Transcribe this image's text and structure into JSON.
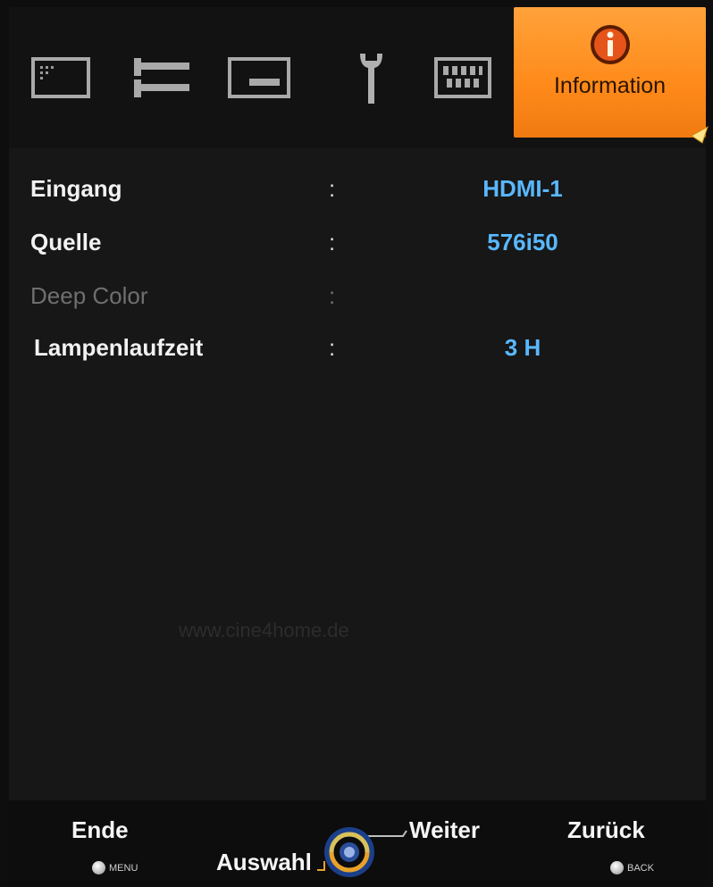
{
  "tabs": [
    {
      "icon": "picture-icon"
    },
    {
      "icon": "signal-input-icon"
    },
    {
      "icon": "screen-icon"
    },
    {
      "icon": "wrench-icon"
    },
    {
      "icon": "memory-icon"
    },
    {
      "icon": "info-icon",
      "label": "Information",
      "active": true
    }
  ],
  "info_rows": [
    {
      "label": "Eingang",
      "colon": ":",
      "value": "HDMI-1"
    },
    {
      "label": "Quelle",
      "colon": ":",
      "value": "576i50"
    },
    {
      "label": "Deep Color",
      "colon": ":",
      "value": ""
    },
    {
      "label": "Lampenlaufzeit",
      "colon": ":",
      "value": "3 H"
    }
  ],
  "watermark": "www.cine4home.de",
  "footer": {
    "end": {
      "label": "Ende",
      "key": "MENU"
    },
    "select": {
      "label": "Auswahl"
    },
    "next": {
      "label": "Weiter"
    },
    "back": {
      "label": "Zurück",
      "key": "BACK"
    }
  },
  "colors": {
    "accent": "#ff8f1f",
    "value_blue": "#59b8ff",
    "disabled_grey": "#6f6f6f"
  }
}
